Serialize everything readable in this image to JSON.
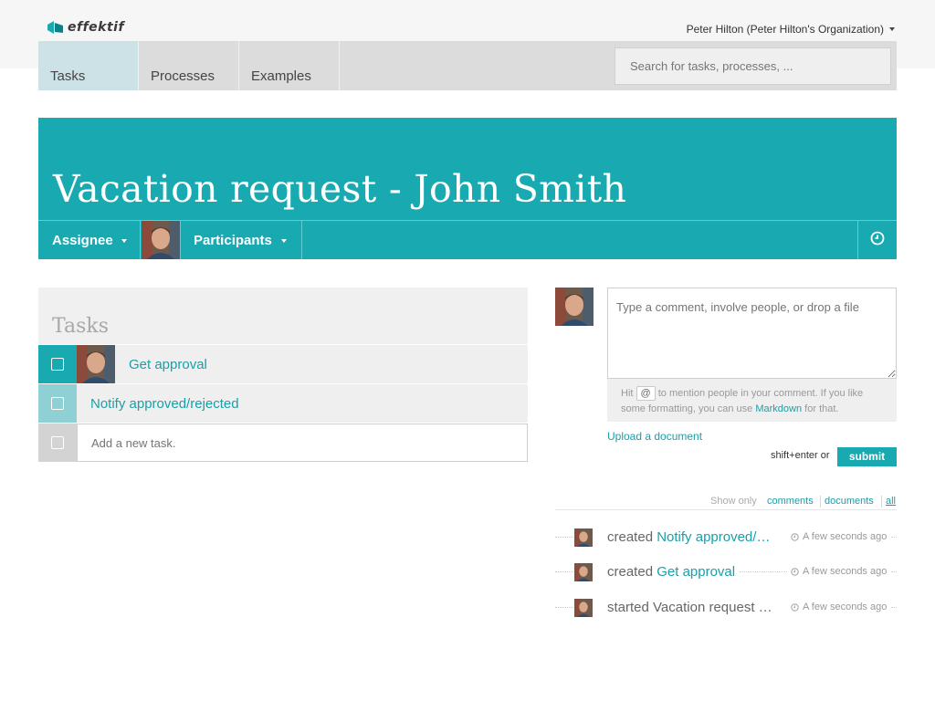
{
  "brand": {
    "name": "effektif",
    "color": "#18a9b1"
  },
  "user_menu": {
    "label": "Peter Hilton (Peter Hilton's Organization)"
  },
  "nav": {
    "tabs": [
      {
        "label": "Tasks",
        "active": true
      },
      {
        "label": "Processes",
        "active": false
      },
      {
        "label": "Examples",
        "active": false
      }
    ],
    "search_placeholder": "Search for tasks, processes, ..."
  },
  "task_header": {
    "title": "Vacation request - John Smith",
    "assignee_label": "Assignee",
    "participants_label": "Participants",
    "history_icon": "clock-icon"
  },
  "subtasks": {
    "heading": "Tasks",
    "items": [
      {
        "label": "Get approval",
        "has_avatar": true,
        "checked": false
      },
      {
        "label": "Notify approved/rejected",
        "has_avatar": false,
        "checked": false
      }
    ],
    "add_placeholder": "Add a new task."
  },
  "comment": {
    "placeholder": "Type a comment, involve people, or drop a file",
    "hint_prefix": "Hit",
    "hint_key": "@",
    "hint_middle": "to mention people in your comment. If you like some formatting, you can use",
    "hint_link": "Markdown",
    "hint_suffix": "for that.",
    "upload_label": "Upload a document",
    "shortcut_label": "shift+enter or",
    "submit_label": "submit"
  },
  "activity_filter": {
    "label": "Show only",
    "options": [
      "comments",
      "documents",
      "all"
    ],
    "selected": "all"
  },
  "activity": [
    {
      "verb": "created",
      "object": "Notify approved/…",
      "time": "A few seconds ago"
    },
    {
      "verb": "created",
      "object": "Get approval",
      "time": "A few seconds ago"
    },
    {
      "verb": "started",
      "object": "Vacation request …",
      "time": "A few seconds ago"
    }
  ],
  "colors": {
    "accent": "#18a9b1",
    "active_tab": "#cde2e6",
    "link": "#1a9fa7"
  }
}
